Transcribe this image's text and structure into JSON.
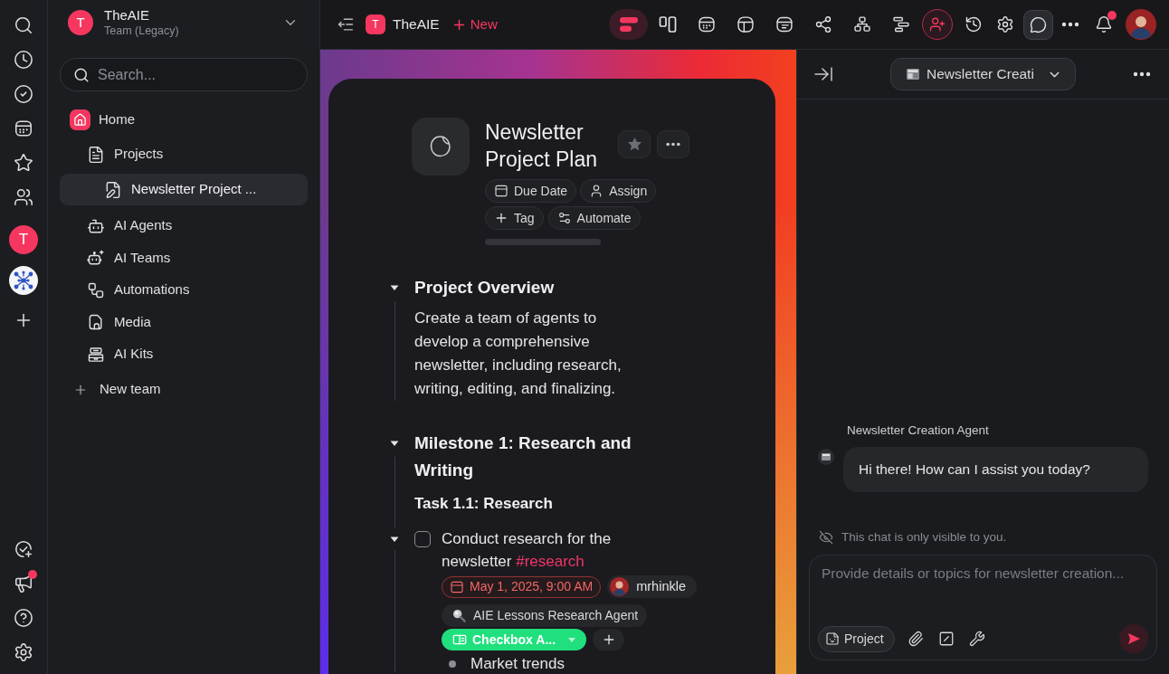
{
  "rail": {
    "team_letter": "T",
    "announcements_unread": true
  },
  "sidebar": {
    "team": {
      "letter": "T",
      "name": "TheAIE",
      "subtitle": "Team (Legacy)"
    },
    "search": {
      "placeholder": "Search..."
    },
    "tree": [
      {
        "label": "Home",
        "selected": false,
        "children": [
          {
            "label": "Projects",
            "selected": false,
            "children": [
              {
                "label": "Newsletter Project ...",
                "selected": true
              }
            ]
          },
          {
            "label": "AI Agents",
            "selected": false
          },
          {
            "label": "AI Teams",
            "selected": false
          },
          {
            "label": "Automations",
            "selected": false
          },
          {
            "label": "Media",
            "selected": false
          },
          {
            "label": "AI Kits",
            "selected": false
          }
        ]
      }
    ],
    "new_team": "New team"
  },
  "topbar": {
    "workspace_letter": "T",
    "workspace_name": "TheAIE",
    "new_label": "New",
    "views": [
      {
        "selected": true
      },
      {
        "selected": false
      },
      {
        "selected": false
      },
      {
        "selected": false
      },
      {
        "selected": false
      },
      {
        "selected": false
      },
      {
        "selected": false
      },
      {
        "selected": false
      }
    ],
    "chat_open": true,
    "notifications_unread": true
  },
  "document": {
    "title": "Newsletter Project Plan",
    "starred": false,
    "properties": [
      {
        "kind": "date",
        "label": "Due Date"
      },
      {
        "kind": "assign",
        "label": "Assign"
      },
      {
        "kind": "tag",
        "label": "Tag"
      },
      {
        "kind": "automate",
        "label": "Automate"
      }
    ],
    "sections": [
      {
        "title": "Project Overview",
        "expanded": true,
        "text": "Create a team of agents to develop a comprehensive newsletter, including research, writing, editing, and finalizing."
      },
      {
        "title": "Milestone 1: Research and Writing",
        "expanded": true,
        "subheading": "Task 1.1: Research",
        "tasks": [
          {
            "text": "Conduct research for the newsletter",
            "tag": "#research",
            "checked": false,
            "expanded": true,
            "due": {
              "label": "May 1, 2025, 9:00 AM",
              "overdue": true
            },
            "assignee": "mrhinkle",
            "agent": "AIE Lessons Research Agent",
            "field": "Checkbox A...",
            "bullets": [
              "Market trends"
            ]
          }
        ]
      }
    ]
  },
  "chat": {
    "agent_select": "Newsletter Creati",
    "messages": [
      {
        "author": "Newsletter Creation Agent",
        "text": "Hi there! How can I assist you today?"
      }
    ],
    "privacy_note": "This chat is only visible to you.",
    "composer": {
      "placeholder": "Provide details or topics for newsletter creation...",
      "context_chip": "Project"
    }
  }
}
